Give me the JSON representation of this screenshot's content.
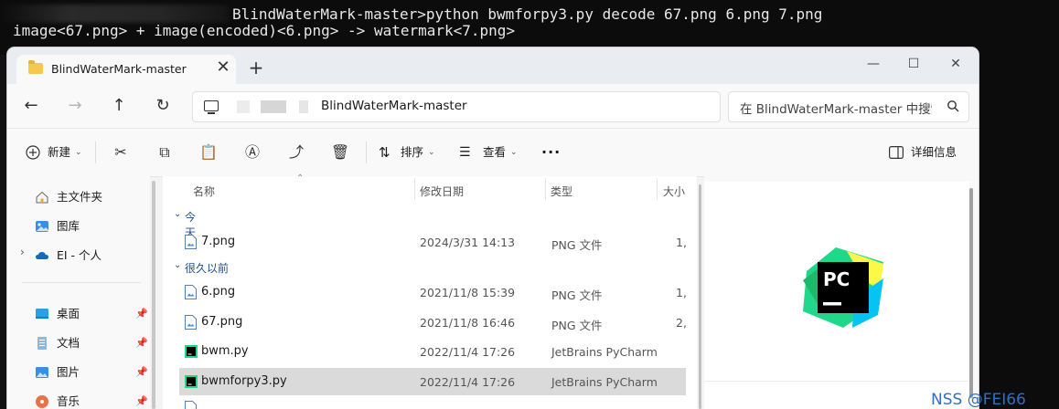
{
  "terminal": {
    "line1": "BlindWaterMark-master>python bwmforpy3.py decode 67.png 6.png 7.png",
    "line2": "image<67.png> + image(encoded)<6.png> -> watermark<7.png>"
  },
  "window": {
    "tab_title": "BlindWaterMark-master",
    "tab_close": "✕",
    "tab_add": "+",
    "minimize": "—",
    "maximize": "☐",
    "close": "✕"
  },
  "address": {
    "path_text": "BlindWaterMark-master",
    "search_placeholder": "在 BlindWaterMark-master 中搜索"
  },
  "toolbar": {
    "new_label": "新建",
    "sort_label": "排序",
    "view_label": "查看",
    "more_label": "···",
    "details_label": "详细信息"
  },
  "nav": {
    "items": [
      {
        "label": "主文件夹",
        "icon": "home-icon"
      },
      {
        "label": "图库",
        "icon": "gallery-icon"
      },
      {
        "label": "EI - 个人",
        "icon": "cloud-icon"
      },
      {
        "label": "桌面",
        "icon": "desktop-icon"
      },
      {
        "label": "文档",
        "icon": "documents-icon"
      },
      {
        "label": "图片",
        "icon": "pictures-icon"
      },
      {
        "label": "音乐",
        "icon": "music-icon"
      }
    ]
  },
  "columns": {
    "name": "名称",
    "date": "修改日期",
    "type": "类型",
    "size": "大小"
  },
  "groups": {
    "today": "今天",
    "long_ago": "很久以前"
  },
  "files": [
    {
      "name": "7.png",
      "date": "2024/3/31 14:13",
      "type": "PNG 文件",
      "size": "1,"
    },
    {
      "name": "6.png",
      "date": "2021/11/8 15:39",
      "type": "PNG 文件",
      "size": "1,"
    },
    {
      "name": "67.png",
      "date": "2021/11/8 16:46",
      "type": "PNG 文件",
      "size": "2,"
    },
    {
      "name": "bwm.py",
      "date": "2022/11/4 17:26",
      "type": "JetBrains PyCharm",
      "size": ""
    },
    {
      "name": "bwmforpy3.py",
      "date": "2022/11/4 17:26",
      "type": "JetBrains PyCharm",
      "size": ""
    }
  ],
  "watermark": "NSS @FEI66",
  "colors": {
    "accent": "#1d4f91",
    "selected_row": "#dadada",
    "pycharm_green": "#21d789"
  }
}
